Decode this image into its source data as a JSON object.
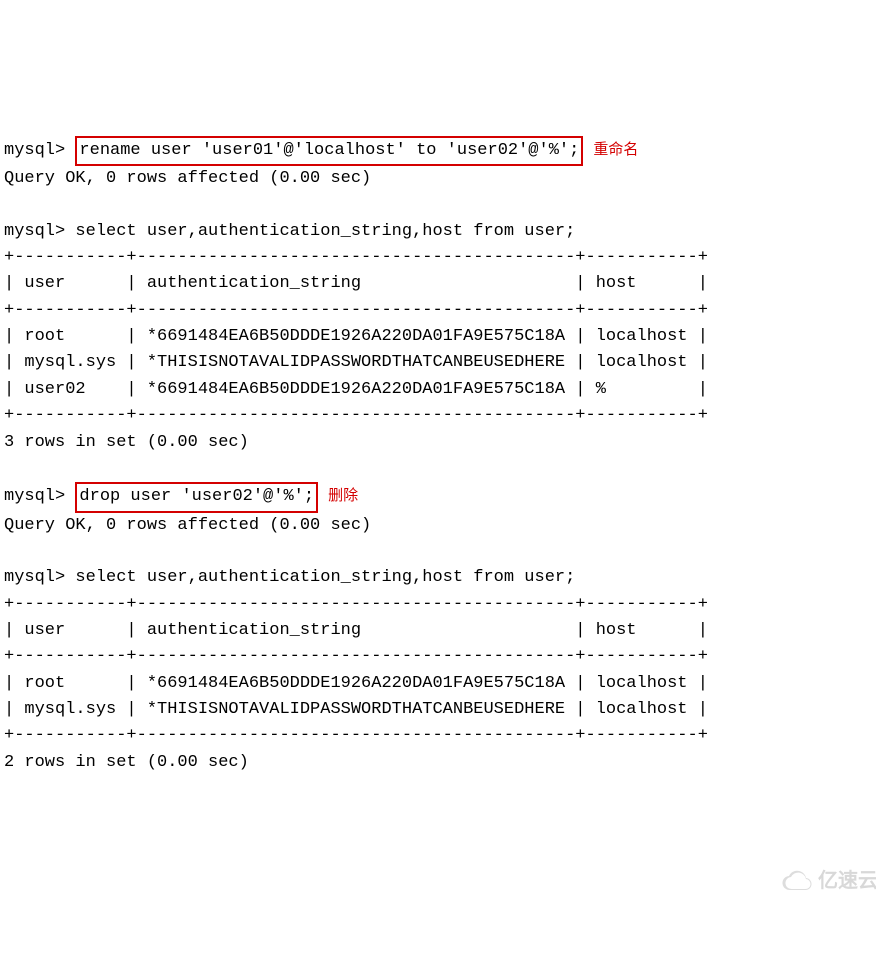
{
  "lines": {
    "prompt": "mysql>",
    "rename_cmd": "rename user 'user01'@'localhost' to 'user02'@'%';",
    "rename_ann": "重命名",
    "rename_result": "Query OK, 0 rows affected (0.00 sec)",
    "select_cmd": "mysql> select user,authentication_string,host from user;",
    "border": "+-----------+-------------------------------------------+-----------+",
    "hdr": "| user      | authentication_string                     | host      |",
    "row1": "| root      | *6691484EA6B50DDDE1926A220DA01FA9E575C18A | localhost |",
    "row2": "| mysql.sys | *THISISNOTAVALIDPASSWORDTHATCANBEUSEDHERE | localhost |",
    "row3": "| user02    | *6691484EA6B50DDDE1926A220DA01FA9E575C18A | %         |",
    "rows_in_set3": "3 rows in set (0.00 sec)",
    "drop_cmd": "drop user 'user02'@'%';",
    "drop_ann": "删除",
    "drop_result": "Query OK, 0 rows affected (0.00 sec)",
    "rows_in_set2": "2 rows in set (0.00 sec)"
  },
  "watermark": "亿速云"
}
